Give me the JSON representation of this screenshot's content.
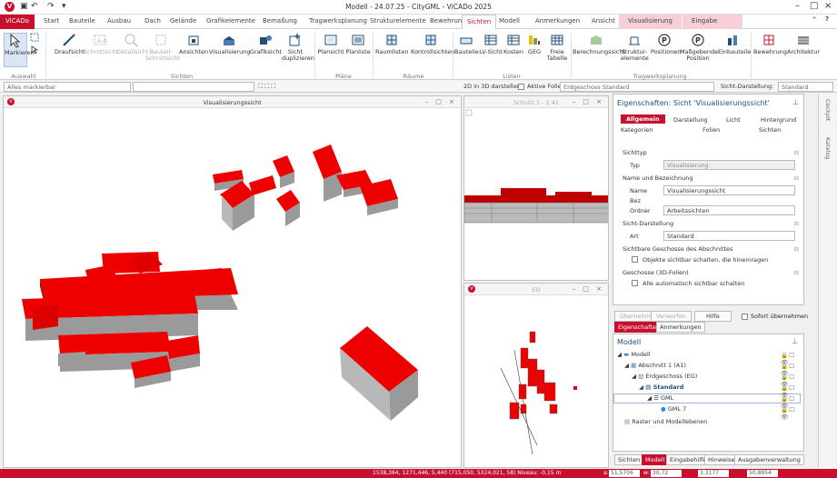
{
  "window": {
    "title": "Modell - 24.07.25 - CityGML - ViCADo 2025"
  },
  "tabs": [
    "ViCADo",
    "Start",
    "Bauteile",
    "Ausbau",
    "Dach",
    "Gelände",
    "Grafikelemente",
    "Bemaßung",
    "Tragwerksplanung",
    "Strukturelemente",
    "Bewehrung",
    "Sichten",
    "Modell",
    "Anmerkungen",
    "Ansicht",
    "Visualisierung",
    "Eingabe"
  ],
  "ribbon": {
    "buttons": [
      "Markieren",
      "Draufsicht",
      "Schnittsicht",
      "Detailsicht",
      "Bauteil-Schnittsicht",
      "Ansichten",
      "Visualisierung",
      "Grafiksicht",
      "Sicht duplizieren",
      "Plansicht",
      "Planliste",
      "Raumlisten",
      "Kontrollsichten",
      "Bauteile",
      "LV-Sicht",
      "Kosten",
      "GEG",
      "Freie Tabelle",
      "Berechnungssicht",
      "Struktur-elemente",
      "Positionen",
      "Maßgebende Position",
      "Einbauteile",
      "Bewehrung",
      "Architektur"
    ],
    "groups": [
      "Auswahl",
      "Sichten",
      "Pläne",
      "Räume",
      "Listen",
      "Tragwerksplanung"
    ]
  },
  "optbar": {
    "filter": "Alles markierbar",
    "sd_label": "2D in 3D darstellen:",
    "folie_label": "Aktive Folie:",
    "folie_value": "Erdgeschoss  Standard",
    "sichtdarst_label": "Sicht-Darstellung:",
    "sichtdarst_value": "Standard"
  },
  "views": {
    "main": "Visualisierungssicht",
    "schnitt": "Schnitt 1 - 1:41",
    "eg": "EG"
  },
  "props": {
    "title": "Eigenschaften: Sicht 'Visualisierungssicht'",
    "tabs": [
      "Allgemein",
      "Darstellung",
      "Licht",
      "Hintergrund",
      "Kategorien",
      "Folien",
      "Sichten"
    ],
    "sichttyp": "Sichttyp",
    "typ_label": "Typ",
    "typ_value": "Visualisierung",
    "name_section": "Name und Bezeichnung",
    "name_label": "Name",
    "name_value": "Visualisierungssicht",
    "bez_label": "Bez",
    "ordner_label": "Ordner",
    "ordner_value": "Arbeitssichten",
    "darst_section": "Sicht-Darstellung",
    "art_label": "Art",
    "art_value": "Standard",
    "geschosse_section": "Sichtbare Geschosse des Abschnittes",
    "geschosse_cb": "Objekte sichtbar schalten, die hineinragen",
    "folien_section": "Geschosse (3D-Folien)",
    "folien_cb": "Alle automatisch sichtbar schalten",
    "btn_apply": "Übernehmen",
    "btn_discard": "Verwerfen",
    "btn_help": "Hilfe",
    "cb_sofort": "Sofort übernehmen"
  },
  "midtabs": [
    "Eigenschaften",
    "Anmerkungen"
  ],
  "tree": {
    "title": "Modell",
    "items": [
      "Modell",
      "Abschnitt 1 (A1)",
      "Erdgeschoss (EG)",
      "Standard",
      "GML",
      "GML 7",
      "Raster und Modellebenen"
    ]
  },
  "bottomtabs": [
    "Sichten",
    "Modell",
    "Eingabehilfe",
    "Hinweise",
    "Ausgabenverwaltung"
  ],
  "side": [
    "Cockpit",
    "Katalog"
  ],
  "status": {
    "coords": "1538,364, 1271,446, 5,440 (715,050, 5324,021, 58)  Niveau: -0,15 m",
    "a_label": "a:",
    "a_value": "51,5706",
    "w_label": "w:",
    "w_value": "30,72",
    "dx_value": "3,3177",
    "dy_value": "50,8954"
  },
  "colors": {
    "accent": "#c8102e",
    "roof": "#ee0000",
    "wall": "#9a9a9a"
  }
}
